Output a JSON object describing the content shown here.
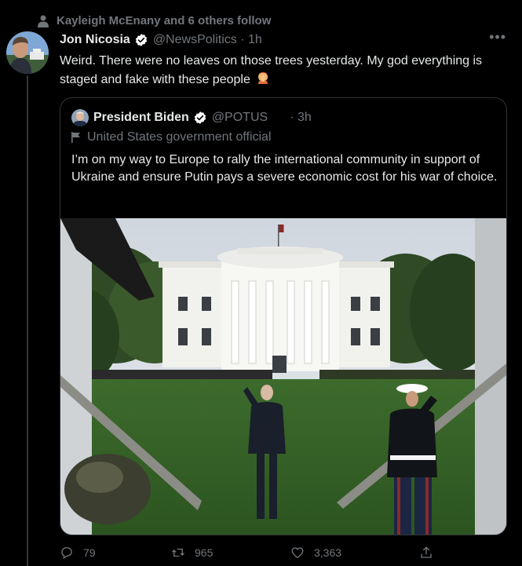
{
  "social_context": "Kayleigh McEnany and 6 others follow",
  "tweet": {
    "name": "Jon Nicosia",
    "handle": "@NewsPolitics",
    "time": "1h",
    "text": "Weird.  There were no leaves on those trees yesterday. My god everything is staged and fake with these people"
  },
  "quote": {
    "name": "President Biden",
    "handle": "@POTUS",
    "time": "· 3h",
    "label": "United States government official",
    "text": "I’m on my way to Europe to rally the international community in support of Ukraine and ensure Putin pays a severe economic cost for his war of choice."
  },
  "actions": {
    "replies": "79",
    "retweets": "965",
    "likes": "3,363"
  },
  "colors": {
    "background": "#000000",
    "text": "#e7e9ea",
    "secondary": "#71767b",
    "verified": "#ffffff",
    "border": "#2f3336"
  },
  "icons": [
    "person-icon",
    "verified-icon",
    "more-icon",
    "flag-icon",
    "reply-icon",
    "retweet-icon",
    "like-icon",
    "share-icon"
  ]
}
